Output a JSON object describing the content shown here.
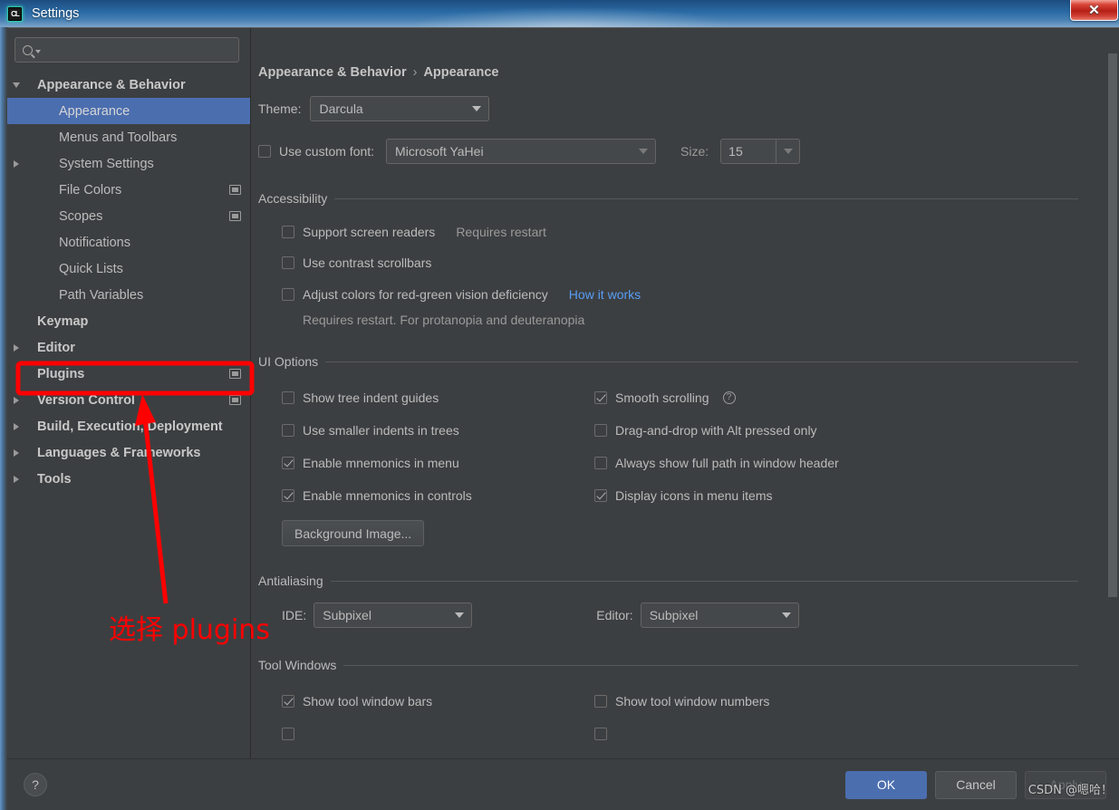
{
  "window": {
    "title": "Settings",
    "app_icon": "clion-app-icon",
    "close_label": "✕"
  },
  "sidebar": {
    "search": {
      "value": "",
      "placeholder": "",
      "icon": "search-icon"
    },
    "items": [
      {
        "label": "Appearance & Behavior",
        "level": 0,
        "arrow": "down",
        "bold": true,
        "selected": false,
        "badge": false
      },
      {
        "label": "Appearance",
        "level": 1,
        "arrow": "none",
        "bold": false,
        "selected": true,
        "badge": false
      },
      {
        "label": "Menus and Toolbars",
        "level": 1,
        "arrow": "none",
        "bold": false,
        "selected": false,
        "badge": false
      },
      {
        "label": "System Settings",
        "level": 1,
        "arrow": "right",
        "bold": false,
        "selected": false,
        "badge": false
      },
      {
        "label": "File Colors",
        "level": 1,
        "arrow": "none",
        "bold": false,
        "selected": false,
        "badge": true
      },
      {
        "label": "Scopes",
        "level": 1,
        "arrow": "none",
        "bold": false,
        "selected": false,
        "badge": true
      },
      {
        "label": "Notifications",
        "level": 1,
        "arrow": "none",
        "bold": false,
        "selected": false,
        "badge": false
      },
      {
        "label": "Quick Lists",
        "level": 1,
        "arrow": "none",
        "bold": false,
        "selected": false,
        "badge": false
      },
      {
        "label": "Path Variables",
        "level": 1,
        "arrow": "none",
        "bold": false,
        "selected": false,
        "badge": false
      },
      {
        "label": "Keymap",
        "level": 0,
        "arrow": "none",
        "bold": true,
        "selected": false,
        "badge": false
      },
      {
        "label": "Editor",
        "level": 0,
        "arrow": "right",
        "bold": true,
        "selected": false,
        "badge": false
      },
      {
        "label": "Plugins",
        "level": 0,
        "arrow": "none",
        "bold": true,
        "selected": false,
        "badge": true,
        "highlighted": true
      },
      {
        "label": "Version Control",
        "level": 0,
        "arrow": "right",
        "bold": true,
        "selected": false,
        "badge": true
      },
      {
        "label": "Build, Execution, Deployment",
        "level": 0,
        "arrow": "right",
        "bold": true,
        "selected": false,
        "badge": false
      },
      {
        "label": "Languages & Frameworks",
        "level": 0,
        "arrow": "right",
        "bold": true,
        "selected": false,
        "badge": false
      },
      {
        "label": "Tools",
        "level": 0,
        "arrow": "right",
        "bold": true,
        "selected": false,
        "badge": false
      }
    ]
  },
  "main": {
    "breadcrumb": {
      "root": "Appearance & Behavior",
      "separator": "›",
      "current": "Appearance"
    },
    "theme": {
      "label": "Theme:",
      "value": "Darcula"
    },
    "custom_font": {
      "checkbox_label": "Use custom font:",
      "checked": false,
      "font_value": "Microsoft YaHei",
      "size_label": "Size:",
      "size_value": "15"
    },
    "accessibility": {
      "title": "Accessibility",
      "options": [
        {
          "label": "Support screen readers",
          "checked": false,
          "note": "Requires restart"
        },
        {
          "label": "Use contrast scrollbars",
          "checked": false,
          "note": ""
        },
        {
          "label": "Adjust colors for red-green vision deficiency",
          "checked": false,
          "link": "How it works"
        }
      ],
      "hint": "Requires restart. For protanopia and deuteranopia"
    },
    "ui_options": {
      "title": "UI Options",
      "left_column": [
        {
          "label": "Show tree indent guides",
          "checked": false
        },
        {
          "label": "Use smaller indents in trees",
          "checked": false
        },
        {
          "label": "Enable mnemonics in menu",
          "checked": true
        },
        {
          "label": "Enable mnemonics in controls",
          "checked": true
        }
      ],
      "right_column": [
        {
          "label": "Smooth scrolling",
          "checked": true,
          "help": true
        },
        {
          "label": "Drag-and-drop with Alt pressed only",
          "checked": false,
          "help": false
        },
        {
          "label": "Always show full path in window header",
          "checked": false,
          "help": false
        },
        {
          "label": "Display icons in menu items",
          "checked": true,
          "help": false
        }
      ],
      "background_image_button": "Background Image..."
    },
    "antialiasing": {
      "title": "Antialiasing",
      "ide_label": "IDE:",
      "ide_value": "Subpixel",
      "editor_label": "Editor:",
      "editor_value": "Subpixel"
    },
    "tool_windows": {
      "title": "Tool Windows",
      "left_column": [
        {
          "label": "Show tool window bars",
          "checked": true
        }
      ],
      "right_column": [
        {
          "label": "Show tool window numbers",
          "checked": false
        }
      ]
    }
  },
  "footer": {
    "help_label": "?",
    "ok_label": "OK",
    "cancel_label": "Cancel",
    "apply_label": "Apply"
  },
  "annotation": {
    "text": "选择 plugins",
    "color": "#ff0000"
  },
  "watermark": {
    "text": "CSDN @嗯哈！"
  },
  "colors": {
    "accent_selection": "#4b6eaf",
    "panel_bg": "#3c3f41",
    "field_bg": "#45484a",
    "text": "#bbbbbb",
    "link": "#589df6",
    "annotation_red": "#ff0000"
  }
}
